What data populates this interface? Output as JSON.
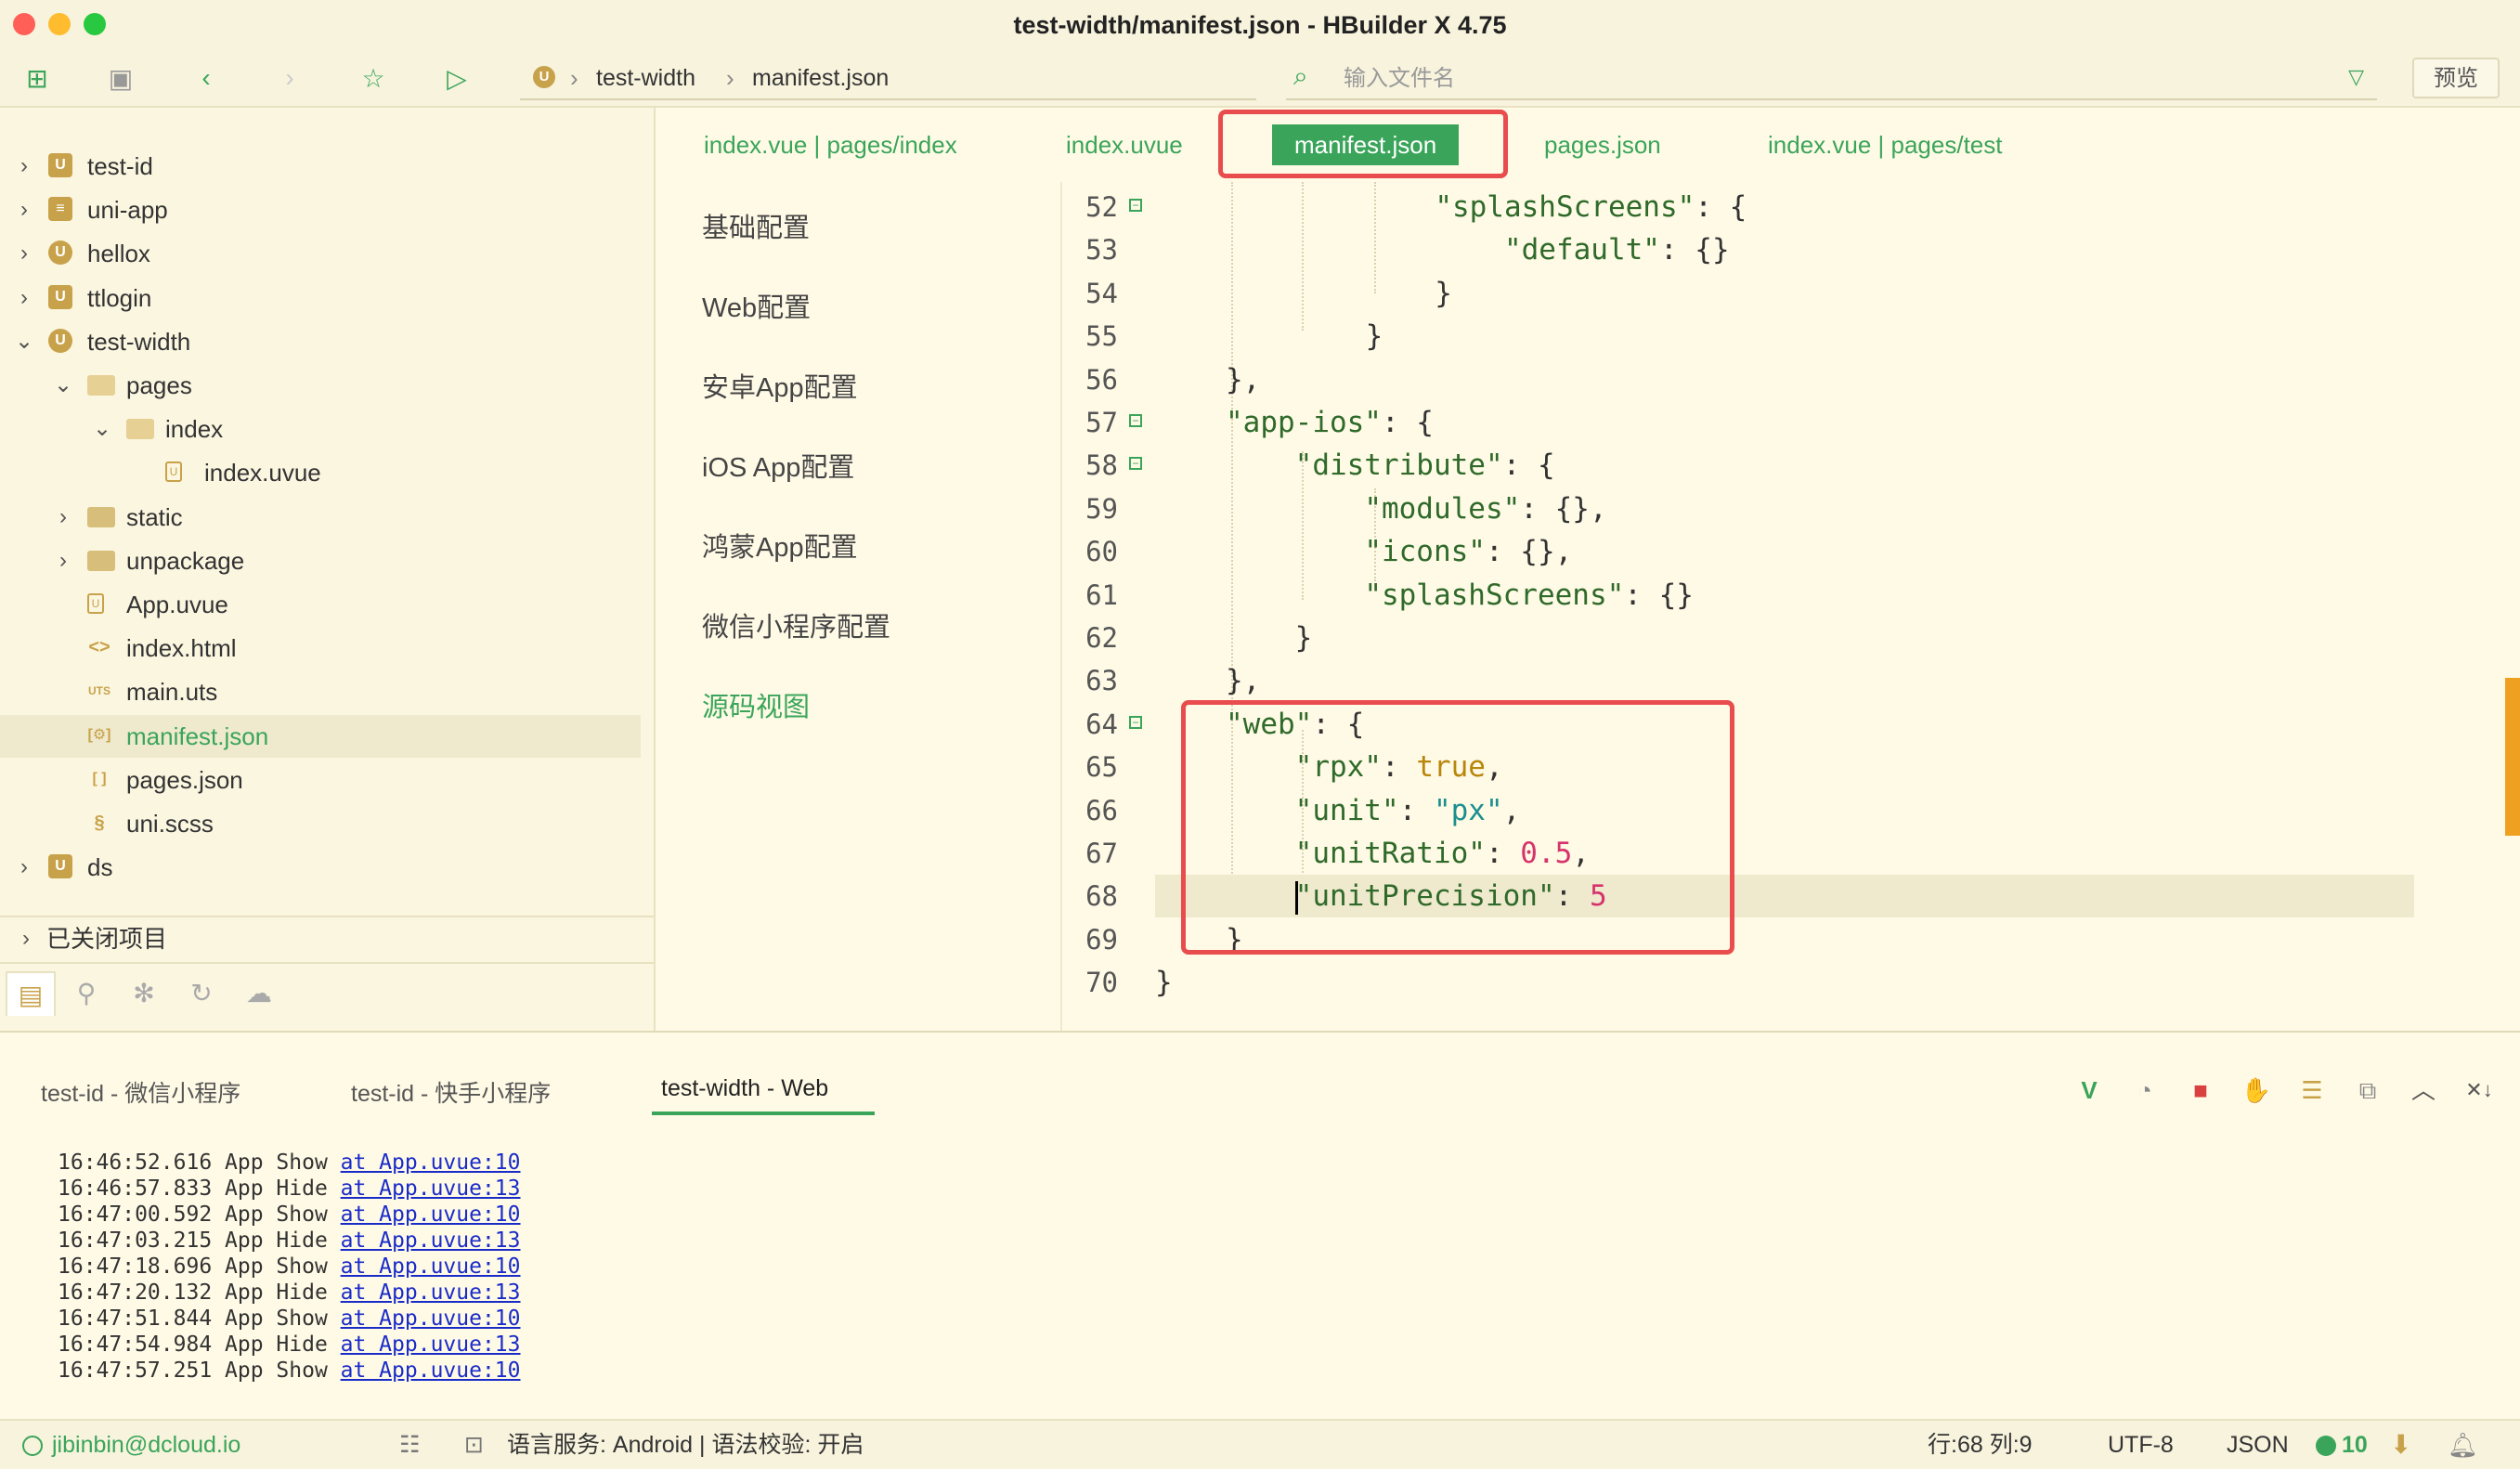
{
  "window": {
    "title": "test-width/manifest.json - HBuilder X 4.75"
  },
  "toolbar": {
    "breadcrumb": [
      "test-width",
      "manifest.json"
    ],
    "search_placeholder": "输入文件名",
    "preview_label": "预览"
  },
  "project_tree": [
    {
      "label": "test-id",
      "type": "project",
      "expanded": false
    },
    {
      "label": "uni-app",
      "type": "project",
      "expanded": false
    },
    {
      "label": "hellox",
      "type": "project",
      "expanded": false
    },
    {
      "label": "ttlogin",
      "type": "project",
      "expanded": false
    },
    {
      "label": "test-width",
      "type": "project",
      "expanded": true
    },
    {
      "label": "pages",
      "type": "folder",
      "expanded": true
    },
    {
      "label": "index",
      "type": "folder",
      "expanded": true
    },
    {
      "label": "index.uvue",
      "type": "file"
    },
    {
      "label": "static",
      "type": "folder",
      "expanded": false
    },
    {
      "label": "unpackage",
      "type": "folder",
      "expanded": false
    },
    {
      "label": "App.uvue",
      "type": "file"
    },
    {
      "label": "index.html",
      "type": "file"
    },
    {
      "label": "main.uts",
      "type": "file"
    },
    {
      "label": "manifest.json",
      "type": "file",
      "selected": true
    },
    {
      "label": "pages.json",
      "type": "file"
    },
    {
      "label": "uni.scss",
      "type": "file"
    },
    {
      "label": "ds",
      "type": "project",
      "expanded": false
    }
  ],
  "closed_projects_label": "已关闭项目",
  "editor_tabs": [
    "index.vue | pages/index",
    "index.uvue",
    "manifest.json",
    "pages.json",
    "index.vue | pages/test"
  ],
  "active_editor_tab": "manifest.json",
  "manifest_nav": [
    "基础配置",
    "Web配置",
    "安卓App配置",
    "iOS App配置",
    "鸿蒙App配置",
    "微信小程序配置",
    "源码视图"
  ],
  "active_manifest_nav": "源码视图",
  "code_lines": [
    {
      "n": "52",
      "text": "        \"splashScreens\": {"
    },
    {
      "n": "53",
      "text": "            \"default\": {}"
    },
    {
      "n": "54",
      "text": "        }"
    },
    {
      "n": "55",
      "text": "    }"
    },
    {
      "n": "56",
      "text": "},"
    },
    {
      "n": "57",
      "text": "\"app-ios\": {"
    },
    {
      "n": "58",
      "text": "    \"distribute\": {"
    },
    {
      "n": "59",
      "text": "        \"modules\": {},"
    },
    {
      "n": "60",
      "text": "        \"icons\": {},"
    },
    {
      "n": "61",
      "text": "        \"splashScreens\": {}"
    },
    {
      "n": "62",
      "text": "    }"
    },
    {
      "n": "63",
      "text": "},"
    },
    {
      "n": "64",
      "text": "\"web\": {"
    },
    {
      "n": "65",
      "text": "    \"rpx\": true,"
    },
    {
      "n": "66",
      "text": "    \"unit\": \"px\","
    },
    {
      "n": "67",
      "text": "    \"unitRatio\": 0.5,"
    },
    {
      "n": "68",
      "text": "    \"unitPrecision\": 5"
    },
    {
      "n": "69",
      "text": "}"
    },
    {
      "n": "70",
      "text": "}"
    }
  ],
  "console": {
    "tabs": [
      "test-id - 微信小程序",
      "test-id - 快手小程序",
      "test-width - Web"
    ],
    "active_tab": "test-width - Web",
    "logs": [
      {
        "prefix": "16:46:52.616 App Show ",
        "link": "at App.uvue:10"
      },
      {
        "prefix": "16:46:57.833 App Hide ",
        "link": "at App.uvue:13"
      },
      {
        "prefix": "16:47:00.592 App Show ",
        "link": "at App.uvue:10"
      },
      {
        "prefix": "16:47:03.215 App Hide ",
        "link": "at App.uvue:13"
      },
      {
        "prefix": "16:47:18.696 App Show ",
        "link": "at App.uvue:10"
      },
      {
        "prefix": "16:47:20.132 App Hide ",
        "link": "at App.uvue:13"
      },
      {
        "prefix": "16:47:51.844 App Show ",
        "link": "at App.uvue:10"
      },
      {
        "prefix": "16:47:54.984 App Hide ",
        "link": "at App.uvue:13"
      },
      {
        "prefix": "16:47:57.251 App Show ",
        "link": "at App.uvue:10"
      }
    ]
  },
  "statusbar": {
    "user": "jibinbin@dcloud.io",
    "language_service": "语言服务: Android | 语法校验: 开启",
    "cursor": "行:68  列:9",
    "encoding": "UTF-8",
    "language": "JSON",
    "notifications": "10"
  },
  "colors": {
    "accent": "#3aa55a",
    "highlight_box": "#e84c4c",
    "background": "#fffae6"
  }
}
